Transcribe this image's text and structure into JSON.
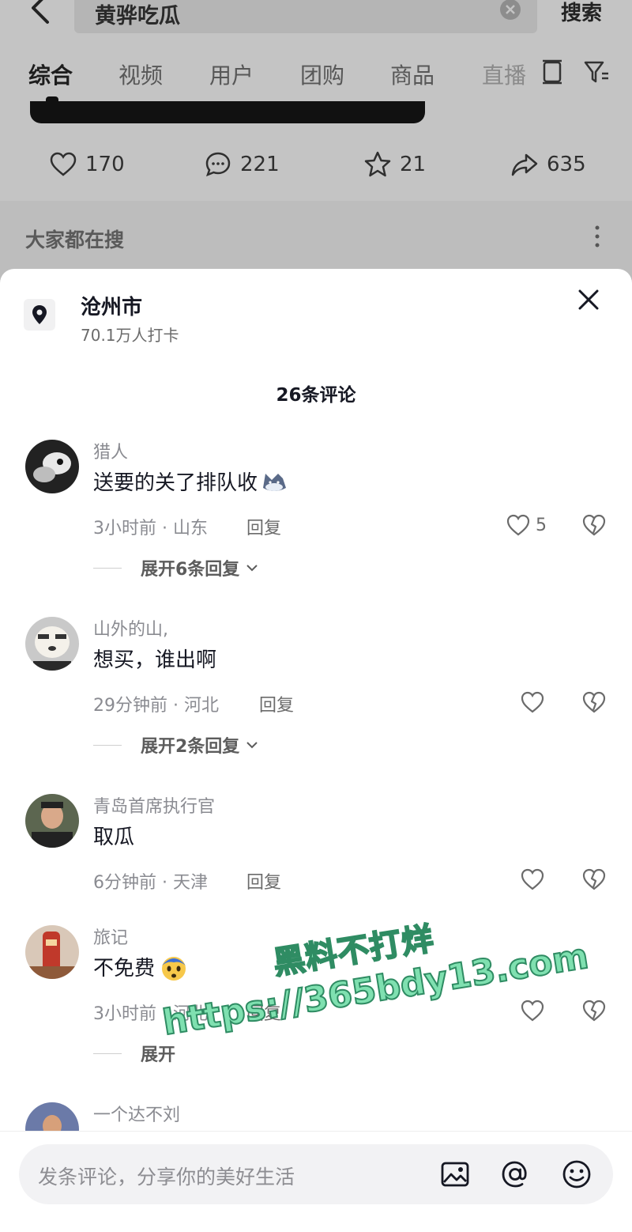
{
  "search": {
    "query": "黄骅吃瓜",
    "button_label": "搜索"
  },
  "tabs": [
    "综合",
    "视频",
    "用户",
    "团购",
    "商品",
    "直播"
  ],
  "stats": {
    "likes": "170",
    "comments": "221",
    "favorites": "21",
    "shares": "635"
  },
  "people_search_title": "大家都在搜",
  "location": {
    "name": "沧州市",
    "checkins": "70.1万人打卡"
  },
  "sheet_title": "26条评论",
  "comments": [
    {
      "user": "猎人",
      "text": "送要的关了排队收",
      "time": "3小时前 · 山东",
      "reply_label": "回复",
      "likes": "5",
      "expand": "展开6条回复"
    },
    {
      "user": "山外的山,",
      "text": "想买，谁出啊",
      "time": "29分钟前 · 河北",
      "reply_label": "回复",
      "likes": "",
      "expand": "展开2条回复"
    },
    {
      "user": "青岛首席执行官",
      "text": "取瓜",
      "time": "6分钟前 · 天津",
      "reply_label": "回复",
      "likes": "",
      "expand": ""
    },
    {
      "user": "旅记",
      "text": "不免费",
      "time": "3小时前 · 河北",
      "reply_label": "回复",
      "likes": "",
      "expand": "展开"
    },
    {
      "user": "一个达不刘",
      "text": "",
      "time": "",
      "reply_label": "",
      "likes": "",
      "expand": ""
    }
  ],
  "watermark": {
    "line1": "黑料不打烊",
    "line2": "https://365bdy13.com"
  },
  "input": {
    "placeholder": "发条评论，分享你的美好生活"
  },
  "colors": {
    "watermark_fill": "#7fe0b0",
    "watermark_stroke": "#2f8c63",
    "overlay_bg": "#c4c4c4"
  }
}
